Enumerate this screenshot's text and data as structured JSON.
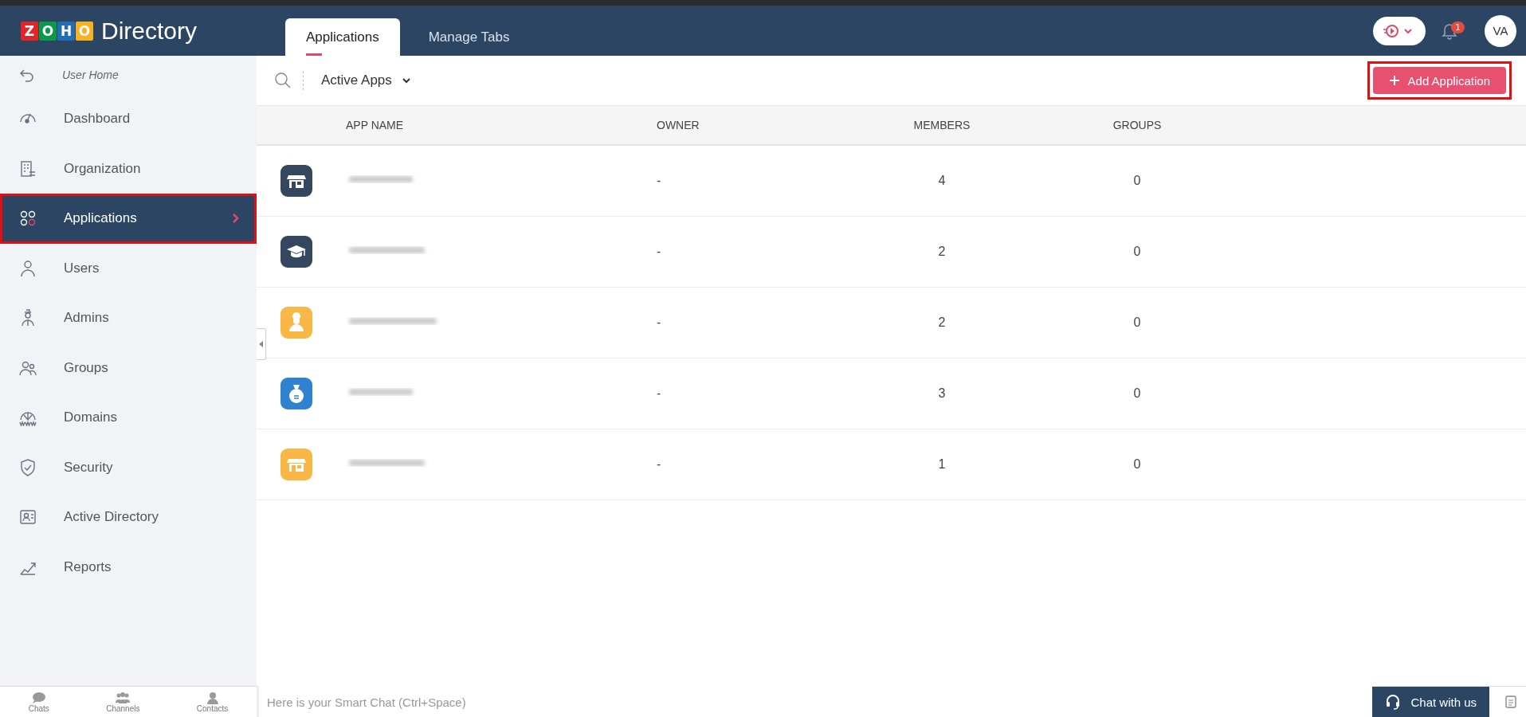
{
  "header": {
    "brand_letters": [
      "Z",
      "O",
      "H",
      "O"
    ],
    "product": "Directory",
    "tabs": [
      {
        "label": "Applications",
        "selected": true
      },
      {
        "label": "Manage Tabs",
        "selected": false
      }
    ],
    "notifications": "1",
    "avatar": "VA"
  },
  "sidebar": {
    "back": "User Home",
    "items": [
      {
        "label": "Dashboard",
        "kind": "gauge",
        "selected": false,
        "highlighted": false
      },
      {
        "label": "Organization",
        "kind": "building",
        "selected": false,
        "highlighted": false
      },
      {
        "label": "Applications",
        "kind": "apps",
        "selected": true,
        "highlighted": true
      },
      {
        "label": "Users",
        "kind": "user",
        "selected": false,
        "highlighted": false
      },
      {
        "label": "Admins",
        "kind": "admin",
        "selected": false,
        "highlighted": false
      },
      {
        "label": "Groups",
        "kind": "group",
        "selected": false,
        "highlighted": false
      },
      {
        "label": "Domains",
        "kind": "www",
        "selected": false,
        "highlighted": false
      },
      {
        "label": "Security",
        "kind": "shield",
        "selected": false,
        "highlighted": false
      },
      {
        "label": "Active Directory",
        "kind": "card",
        "selected": false,
        "highlighted": false
      },
      {
        "label": "Reports",
        "kind": "chart",
        "selected": false,
        "highlighted": false
      }
    ]
  },
  "toolbar": {
    "filter": "Active Apps",
    "add_button": {
      "label": "Add Application",
      "highlighted": true
    }
  },
  "table": {
    "columns": [
      "APP NAME",
      "OWNER",
      "MEMBERS",
      "GROUPS"
    ],
    "rows": [
      {
        "kind": "store",
        "color": "#34475f",
        "owner": "-",
        "members": "4",
        "groups": "0"
      },
      {
        "kind": "graduation-cap",
        "color": "#34475f",
        "owner": "-",
        "members": "2",
        "groups": "0"
      },
      {
        "kind": "chef",
        "color": "#f9b846",
        "owner": "-",
        "members": "2",
        "groups": "0"
      },
      {
        "kind": "money-bag",
        "color": "#2f82d0",
        "owner": "-",
        "members": "3",
        "groups": "0"
      },
      {
        "kind": "store",
        "color": "#f9b846",
        "owner": "-",
        "members": "1",
        "groups": "0"
      }
    ]
  },
  "bottom_bar": {
    "shortcuts": [
      {
        "label": "Chats",
        "kind": "chat"
      },
      {
        "label": "Channels",
        "kind": "people"
      },
      {
        "label": "Contacts",
        "kind": "person"
      }
    ],
    "smart_chat": {
      "placeholder": "Here is your Smart Chat (Ctrl+Space)"
    },
    "chat_button": "Chat with us"
  }
}
